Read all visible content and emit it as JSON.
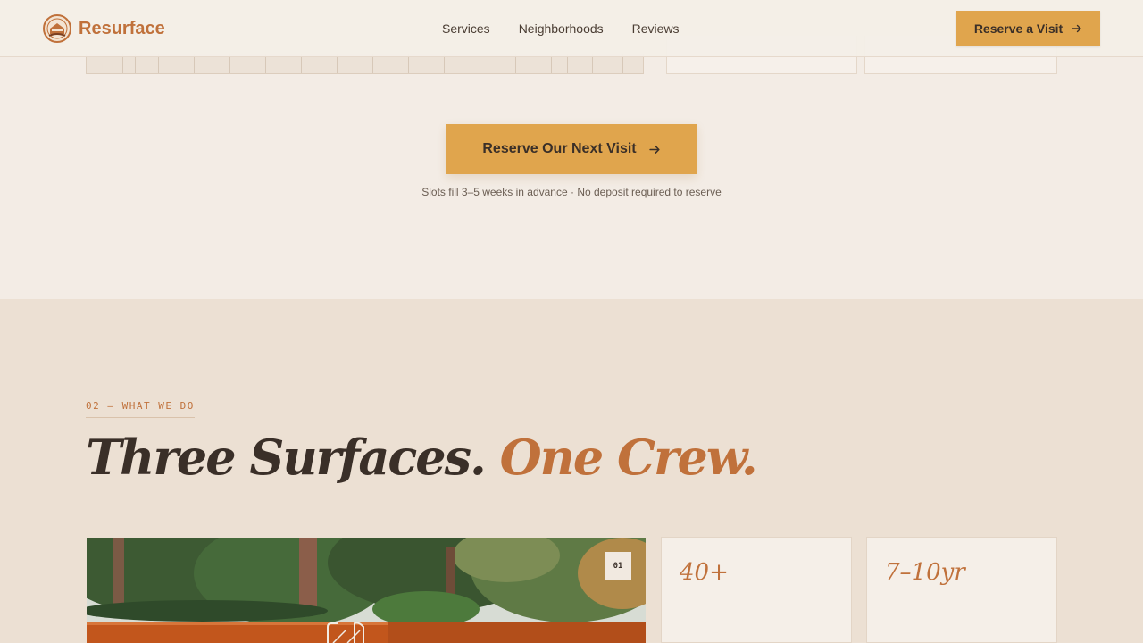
{
  "header": {
    "brand": "Resurface",
    "nav": [
      "Services",
      "Neighborhoods",
      "Reviews"
    ],
    "cta_label": "Reserve a Visit"
  },
  "booking": {
    "cta_label": "Reserve Our Next Visit",
    "note": "Slots fill 3–5 weeks in advance · No deposit required to reserve"
  },
  "services": {
    "eyebrow": "02 — WHAT WE DO",
    "heading_main": "Three Surfaces.",
    "heading_accent": "One Crew.",
    "photo_badge": "01",
    "stats": [
      "40+",
      "7–10yr"
    ]
  },
  "colors": {
    "accent": "#e0a54d",
    "brand": "#c0713b",
    "page_bg": "#f3ece5",
    "section_bg": "#ece0d3"
  },
  "icons": {
    "logo": "house-sun-emblem",
    "cta": "arrow-right-icon"
  }
}
